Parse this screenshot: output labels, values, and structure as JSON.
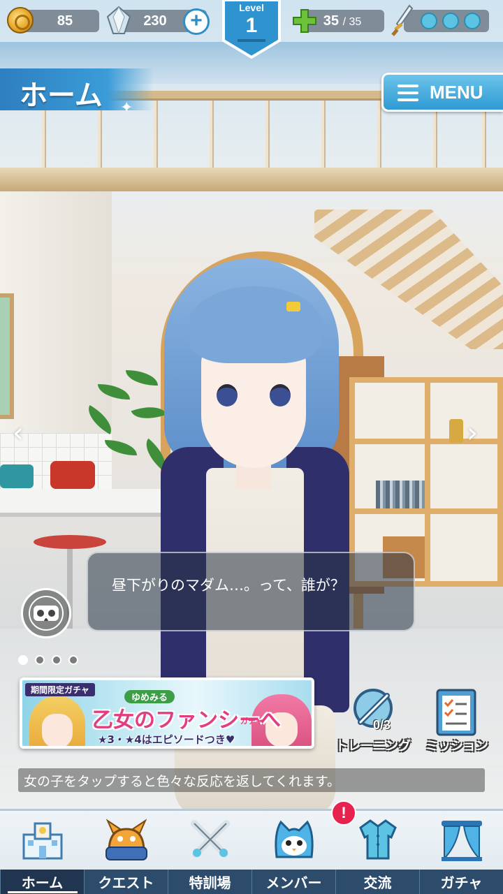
{
  "status": {
    "coins": "85",
    "gems": "230",
    "gem_add_symbol": "+",
    "level_label": "Level",
    "level_value": "1",
    "stamina_current": "35",
    "stamina_max": "/ 35",
    "sword_slots": 3
  },
  "header": {
    "title": "ホーム",
    "menu_label": "MENU"
  },
  "dialogue": {
    "text": "昼下がりのマダム…。って、誰が？"
  },
  "carousel": {
    "page_count": 4,
    "active_index": 0
  },
  "banner": {
    "tag": "期間限定ガチャ",
    "subtitle": "ゆめみる",
    "title": "乙女のファンシーへ",
    "gacha": "ガチャ",
    "footer": "★3・★4はエピソードつき♥"
  },
  "side_buttons": {
    "training_label": "トレーニング",
    "training_count": "0/3",
    "mission_label": "ミッション"
  },
  "tip": {
    "text": "女の子をタップすると色々な反応を返してくれます。"
  },
  "nav": {
    "items": [
      {
        "label": "ホーム",
        "icon": "school-icon",
        "active": true
      },
      {
        "label": "クエスト",
        "icon": "monster-icon",
        "active": false
      },
      {
        "label": "特訓場",
        "icon": "crossed-swords-icon",
        "active": false
      },
      {
        "label": "メンバー",
        "icon": "cat-mascot-icon",
        "active": false
      },
      {
        "label": "交流",
        "icon": "uniform-icon",
        "active": false
      },
      {
        "label": "ガチャ",
        "icon": "curtain-icon",
        "active": false
      }
    ],
    "notice_badge": "!"
  },
  "colors": {
    "accent_blue": "#3b9cd8",
    "nav_dark": "#2d4c6c",
    "badge_red": "#e8224f",
    "banner_pink": "#e23d7e"
  }
}
